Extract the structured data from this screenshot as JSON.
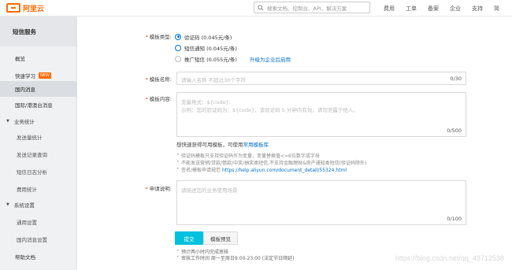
{
  "header": {
    "brand": "阿里云",
    "search_placeholder": "搜索文档、控制台、API、解决方案",
    "nav": [
      "费用",
      "工单",
      "备案",
      "企业",
      "支持",
      "简"
    ]
  },
  "sidebar": {
    "title": "短信服务",
    "items": [
      {
        "label": "概览",
        "type": "item"
      },
      {
        "label": "快速学习",
        "type": "item",
        "badge": "NEW"
      },
      {
        "label": "国内消息",
        "type": "item",
        "active": true
      },
      {
        "label": "国际/港澳台消息",
        "type": "item"
      },
      {
        "label": "业务统计",
        "type": "group"
      },
      {
        "label": "发送量统计",
        "type": "sub"
      },
      {
        "label": "发送记录查询",
        "type": "sub"
      },
      {
        "label": "短信日志分析",
        "type": "sub"
      },
      {
        "label": "费用统计",
        "type": "sub"
      },
      {
        "label": "系统设置",
        "type": "group"
      },
      {
        "label": "通用设置",
        "type": "sub"
      },
      {
        "label": "国内消息设置",
        "type": "sub"
      },
      {
        "label": "帮助文档",
        "type": "item"
      }
    ]
  },
  "form": {
    "template_type": {
      "label": "模板类型:",
      "options": [
        {
          "label": "验证码 (0.045元/条)",
          "selected": true
        },
        {
          "label": "短信通知 (0.045元/条)",
          "selected": false
        },
        {
          "label": "推广短信 (0.055元/条)",
          "selected": false
        }
      ],
      "upgrade_link": "升级为企业后启用"
    },
    "template_name": {
      "label": "模板名称:",
      "placeholder": "请输入名称 不超过30个字符",
      "counter": "0/30"
    },
    "template_content": {
      "label": "模板内容:",
      "placeholder_line1": "变量格式：${code};",
      "placeholder_line2": "示例：您的验证码为：${code}，该验证码 5 分钟内有效，请勿泄露于他人。",
      "counter": "0/500",
      "tip_prefix": "想快速获得可用模板，可使用",
      "tip_link": "常用模板库",
      "rules": [
        "验证码模板只支持验证码作为变量，变量替换值<=6位数字或字母",
        "不能发送营销/贷款/借款/中奖/抽奖类短信,不支持金融理财&房产通知类短信(验证码除外)",
        "签名/模板申请规范"
      ],
      "rules_link": "https://help.aliyun.com/document_detail/55324.html"
    },
    "application": {
      "label": "申请说明:",
      "placeholder": "请描述您的业务使用场景",
      "counter": "0/100"
    },
    "submit_label": "提交",
    "preview_label": "模板预览",
    "notes": [
      "预计两小时内完成审核",
      "审核工作时间 周一至周日9:00-23:00 (法定节日顺延)"
    ]
  },
  "watermark": "https://blog.csdn.net/qq_43712538"
}
